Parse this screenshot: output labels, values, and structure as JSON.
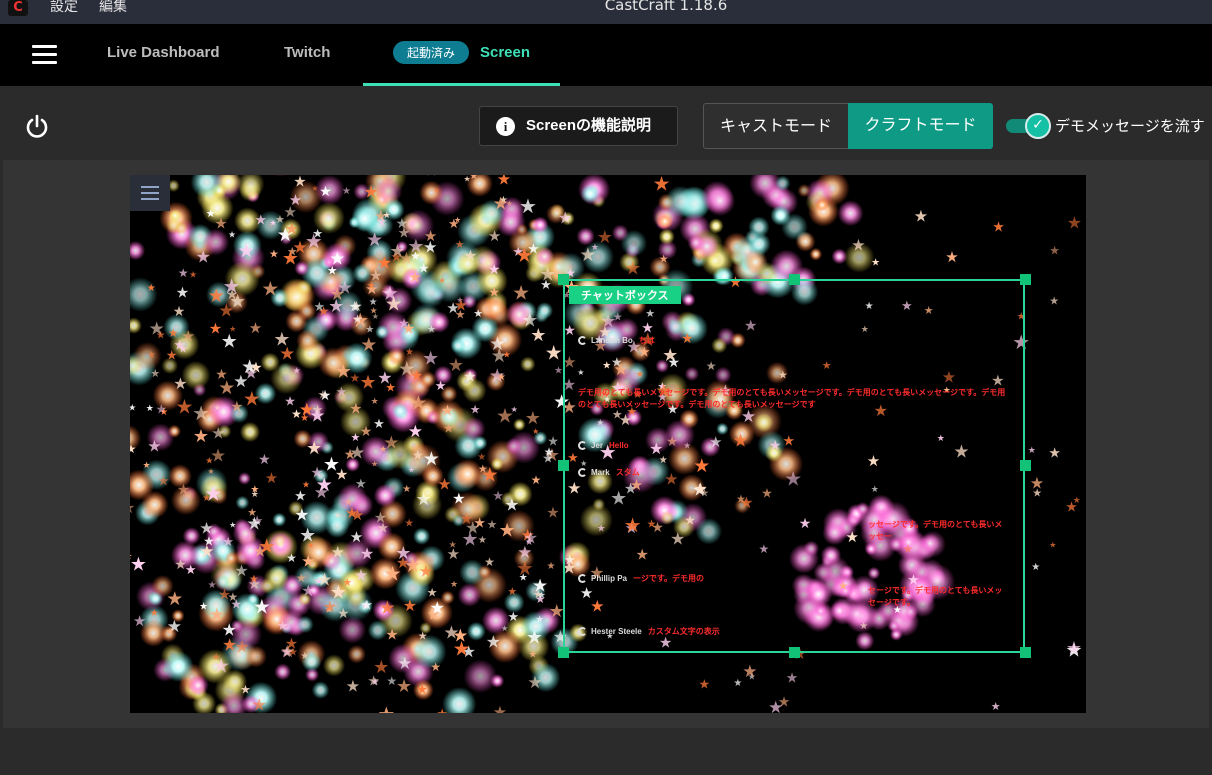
{
  "titlebar": {
    "menu_settings": "設定",
    "menu_edit": "編集",
    "title": "CastCraft 1.18.6"
  },
  "nav": {
    "tabs": [
      {
        "label": "Live Dashboard"
      },
      {
        "label": "Twitch"
      },
      {
        "label": "Screen",
        "badge": "起動済み",
        "active": true
      }
    ]
  },
  "toolbar": {
    "help_label": "Screenの機能説明",
    "mode_cast": "キャストモード",
    "mode_craft": "クラフトモード",
    "active_mode": "クラフトモード",
    "demo_toggle_label": "デモメッセージを流す",
    "demo_toggle_on": true
  },
  "canvas": {
    "chatbox_label": "チャットボックス",
    "chat": [
      {
        "name": "Landon Bo",
        "msg": "ちは"
      },
      {
        "name": "Jer",
        "msg": "Hello"
      },
      {
        "name": "Mark",
        "msg": "スタム"
      },
      {
        "name": "Phillip Pa",
        "msg": "ージです。デモ用の"
      },
      {
        "name": "Hester Steele",
        "msg": "カスタム文字の表示"
      }
    ],
    "long_msg_1": "デモ用のとても長いメッセージです。デモ用のとても長いメッセージです。デモ用のとても長いメッセージです。デモ用のとても長いメッセージです。デモ用のとても長いメッセージです",
    "long_msg_2": "ッセージです。デモ用のとても長いメッセー",
    "long_msg_3": "セージです。デモ用のとても長いメッセージです。"
  },
  "colors": {
    "accent": "#3de0b7",
    "craft_mode": "#0e9a85",
    "selection": "#2bd59a",
    "chat_message": "#ff2c2c"
  }
}
